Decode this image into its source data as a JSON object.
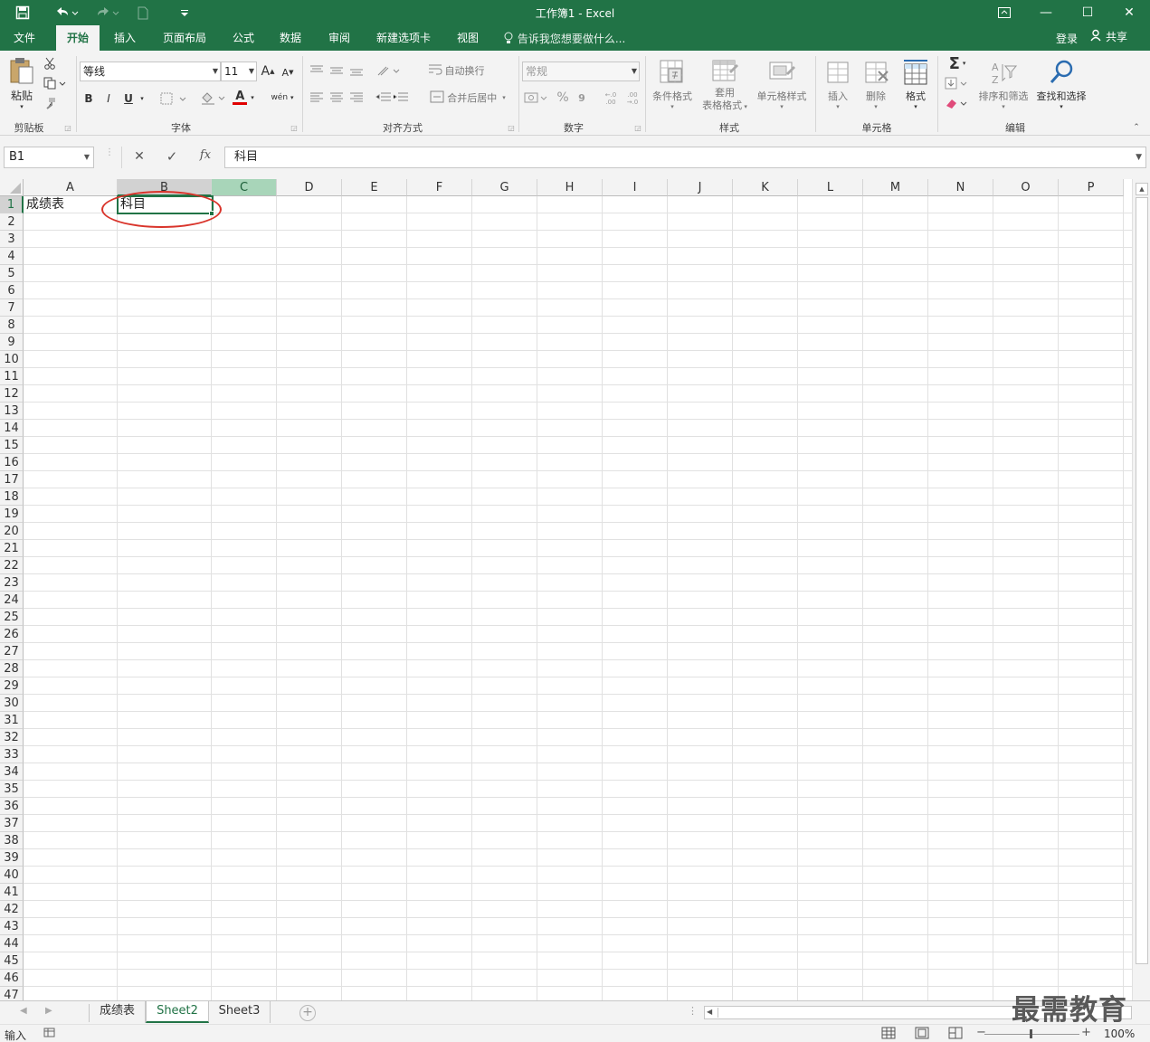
{
  "window": {
    "title": "工作簿1 - Excel",
    "restore_icon": "ribbon-display-icon",
    "minimize": "—",
    "maximize": "☐",
    "close": "✕"
  },
  "quick_access": {
    "save_icon": "save-icon",
    "undo_icon": "undo-icon",
    "redo_icon": "redo-icon",
    "new_icon": "new-document-icon",
    "customize_icon": "customize-qat-icon"
  },
  "ribbon_tabs": [
    "文件",
    "开始",
    "插入",
    "页面布局",
    "公式",
    "数据",
    "审阅",
    "新建选项卡",
    "视图"
  ],
  "active_tab": "开始",
  "tell_me": "告诉我您想要做什么...",
  "account": {
    "login": "登录",
    "share": "共享"
  },
  "ribbon": {
    "clipboard": {
      "paste": "粘贴",
      "label": "剪贴板"
    },
    "font": {
      "name": "等线",
      "size": "11",
      "bold": "B",
      "italic": "I",
      "underline": "U",
      "grow": "A",
      "shrink": "A",
      "color_letter": "A",
      "phonetic": "wén",
      "label": "字体"
    },
    "alignment": {
      "wrap": "自动换行",
      "merge": "合并后居中",
      "label": "对齐方式"
    },
    "number": {
      "format": "常规",
      "percent": "%",
      "comma": "9",
      "inc_decimal": "←.0 .00",
      "dec_decimal": ".00 →.0",
      "label": "数字"
    },
    "styles": {
      "conditional": "条件格式",
      "table_line1": "套用",
      "table_line2": "表格格式",
      "cell_styles": "单元格样式",
      "label": "样式"
    },
    "cells": {
      "insert": "插入",
      "delete": "删除",
      "format": "格式",
      "label": "单元格"
    },
    "editing": {
      "sort": "排序和筛选",
      "find": "查找和选择",
      "label": "编辑"
    },
    "collapse_icon": "collapse-ribbon-icon"
  },
  "formula_bar": {
    "name_box": "B1",
    "cancel": "✕",
    "enter": "✓",
    "fx": "fx",
    "content": "科目"
  },
  "columns": [
    "A",
    "B",
    "C",
    "D",
    "E",
    "F",
    "G",
    "H",
    "I",
    "J",
    "K",
    "L",
    "M",
    "N",
    "O",
    "P"
  ],
  "rows": [
    "1",
    "2",
    "3",
    "4",
    "5",
    "6",
    "7",
    "8",
    "9",
    "10",
    "11",
    "12",
    "13",
    "14",
    "15",
    "16",
    "17",
    "18",
    "19",
    "20",
    "21",
    "22",
    "23",
    "24",
    "25",
    "26",
    "27",
    "28",
    "29",
    "30",
    "31",
    "32",
    "33",
    "34",
    "35",
    "36",
    "37",
    "38",
    "39",
    "40",
    "41",
    "42",
    "43",
    "44",
    "45",
    "46",
    "47"
  ],
  "cells": {
    "A1": "成绩表",
    "B1": "科目"
  },
  "selected_cell": "B1",
  "sheets": [
    "成绩表",
    "Sheet2",
    "Sheet3"
  ],
  "active_sheet": "Sheet2",
  "status": {
    "mode": "输入",
    "zoom": "100%",
    "minus": "−",
    "plus": "+"
  },
  "watermark": "最需教育",
  "accent": "#217346",
  "callout_color": "#d9342b"
}
